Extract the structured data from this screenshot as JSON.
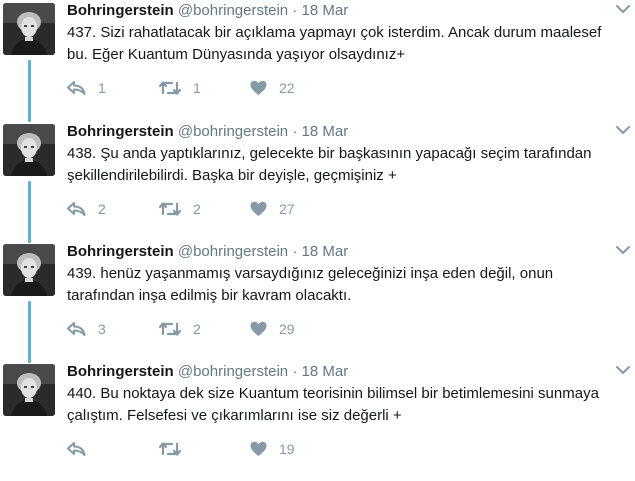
{
  "colors": {
    "thread_line": "#5ab4d4",
    "icon_gray": "#8899a6",
    "meta_gray": "#657786"
  },
  "icons": {
    "reply": "reply-icon",
    "retweet": "retweet-icon",
    "like": "heart-icon",
    "menu": "chevron-down-icon"
  },
  "tweets": [
    {
      "name": "Bohringerstein",
      "handle": "@bohringerstein",
      "separator": "·",
      "time": "18 Mar",
      "line1": "437. Sizi rahatlatacak bir açıklama yapmayı çok isterdim. Ancak durum maalesef",
      "line2": "bu. Eğer Kuantum Dünyasında yaşıyor olsaydınız+",
      "replies": "1",
      "retweets": "1",
      "likes": "22"
    },
    {
      "name": "Bohringerstein",
      "handle": "@bohringerstein",
      "separator": "·",
      "time": "18 Mar",
      "line1": "438. Şu anda yaptıklarınız, gelecekte bir başkasının yapacağı seçim tarafından",
      "line2": "şekillendirilebilirdi. Başka bir deyişle, geçmişiniz +",
      "replies": "2",
      "retweets": "2",
      "likes": "27"
    },
    {
      "name": "Bohringerstein",
      "handle": "@bohringerstein",
      "separator": "·",
      "time": "18 Mar",
      "line1": "439. henüz yaşanmamış varsaydığınız geleceğinizi inşa eden değil, onun",
      "line2": "tarafından inşa edilmiş bir kavram olacaktı.",
      "replies": "3",
      "retweets": "2",
      "likes": "29"
    },
    {
      "name": "Bohringerstein",
      "handle": "@bohringerstein",
      "separator": "·",
      "time": "18 Mar",
      "line1": "440. Bu noktaya dek size Kuantum teorisinin bilimsel bir betimlemesini sunmaya",
      "line2": "çalıştım. Felsefesi ve çıkarımlarını ise siz değerli +",
      "replies": "",
      "retweets": "",
      "likes": "19"
    }
  ]
}
